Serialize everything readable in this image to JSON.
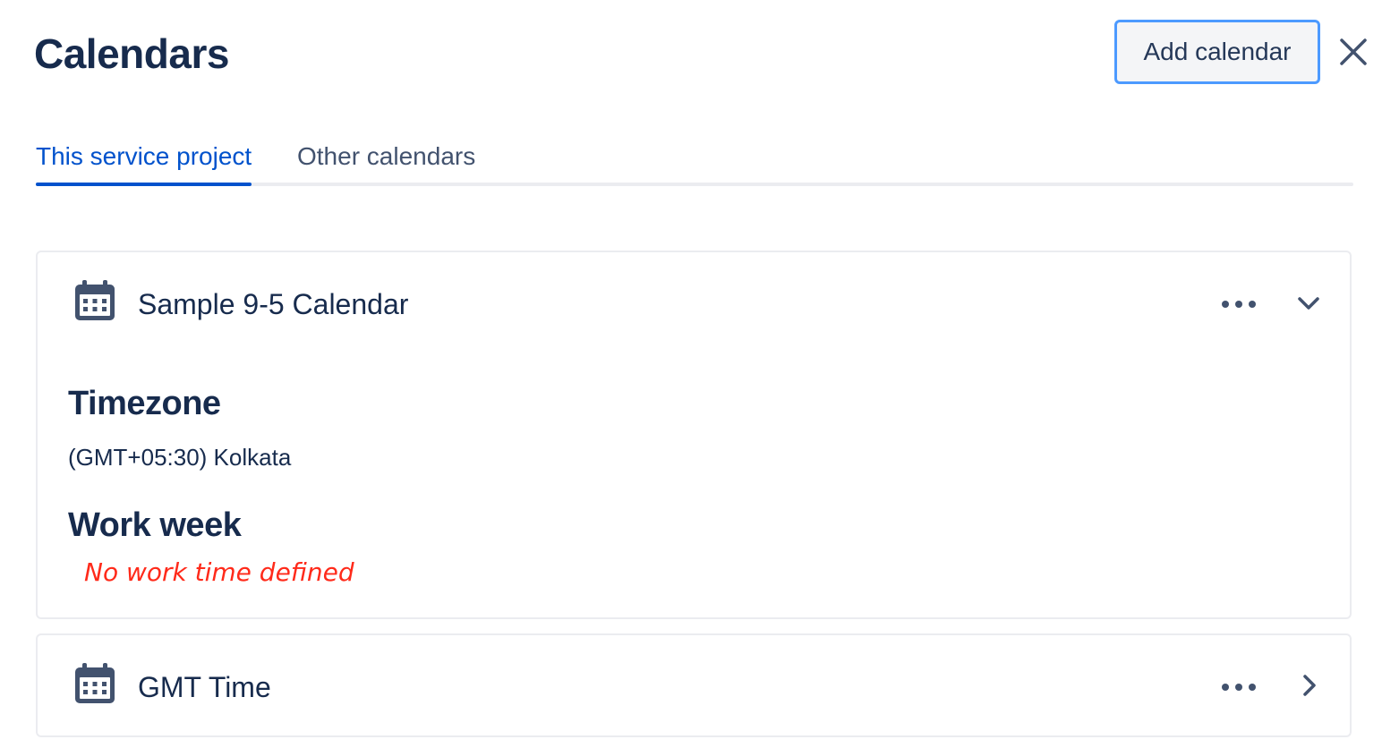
{
  "header": {
    "title": "Calendars",
    "add_button_label": "Add calendar",
    "close_icon": "close-icon"
  },
  "tabs": [
    {
      "label": "This service project",
      "active": true
    },
    {
      "label": "Other calendars",
      "active": false
    }
  ],
  "calendars": [
    {
      "name": "Sample 9-5 Calendar",
      "icon": "calendar-icon",
      "expanded": true,
      "details": {
        "timezone_heading": "Timezone",
        "timezone_value": "(GMT+05:30) Kolkata",
        "work_week_heading": "Work week",
        "work_week_note": "No work time defined"
      }
    },
    {
      "name": "GMT Time",
      "icon": "calendar-icon",
      "expanded": false
    }
  ],
  "colors": {
    "accent": "#0052cc",
    "focus_ring": "#4c9aff",
    "text": "#172b4d",
    "note": "#ff2a1a"
  }
}
